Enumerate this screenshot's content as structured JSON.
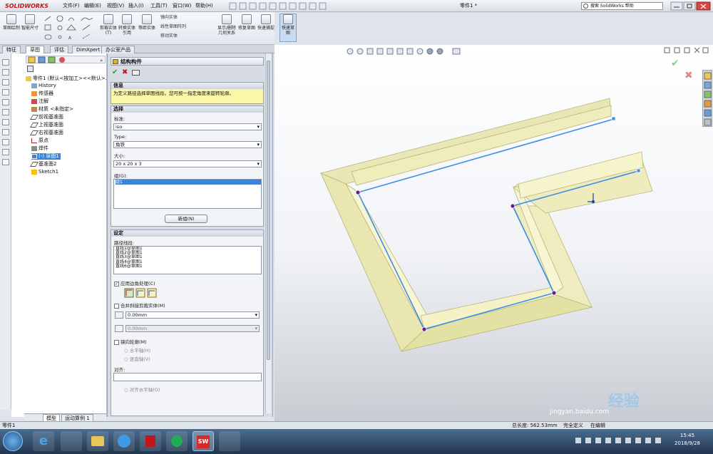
{
  "app": {
    "brand": "SOLIDWORKS",
    "doc_title": "零件1 *",
    "help_search_placeholder": "搜索 SolidWorks 帮助"
  },
  "menu": [
    "文件(F)",
    "编辑(E)",
    "视图(V)",
    "插入(I)",
    "工具(T)",
    "窗口(W)",
    "帮助(H)"
  ],
  "ribbon": {
    "sketch": "草图绘制",
    "smart_dim": "智能尺寸",
    "trim": "剪裁实体(T)",
    "convert": "转换实体引用",
    "offset": "等距实体",
    "mirror": "镜向实体",
    "linear_pattern": "线性草图阵列",
    "move": "移动实体",
    "show_delete": "显示/删除几何关系",
    "repair": "修复草图",
    "quick_snap": "快速捕捉",
    "rapid_sketch": "快速草图"
  },
  "tabs": [
    "特征",
    "草图",
    "评估",
    "DimXpert",
    "办公室产品"
  ],
  "tree": {
    "root": "零件1 (默认<按加工><<默认>...",
    "items": [
      "History",
      "传感器",
      "注解",
      "材质 <未指定>",
      "前视基准面",
      "上视基准面",
      "右视基准面",
      "原点",
      "焊件",
      "(-) 草图1",
      "基准面2",
      "Sketch1"
    ]
  },
  "pm": {
    "title": "结构构件",
    "info_header": "信息",
    "info_text": "为定义路径选择草图线段。您可按一指定角度来旋转轮廓。",
    "sel_header": "选择",
    "standard_label": "标准:",
    "standard": "iso",
    "type_label": "Type:",
    "type": "角铁",
    "size_label": "大小:",
    "size": "20 x 20 x 3",
    "group_label": "组(G):",
    "group_item": "组1",
    "new_group": "新组(N)",
    "settings_header": "设定",
    "path_label": "路径线段:",
    "path_items": [
      "直线1@草图1",
      "直线2@草图1",
      "直线3@草图1",
      "直线4@草图1",
      "直线6@草图1"
    ],
    "corner": "应用边角处理(C)",
    "merge": "合并斜接剪裁实体(M)",
    "gap1": "0.00mm",
    "gap2": "0.00mm",
    "mirror_profile": "镜向轮廓(M)",
    "horiz_axis": "水平轴(H)",
    "vert_axis": "竖直轴(V)",
    "align_label": "对齐:",
    "align_horiz": "对齐水平轴(O)"
  },
  "bottom_tabs": [
    "模型",
    "运动算例 1"
  ],
  "status": {
    "left": "零件1",
    "length": "总长度: 562.53mm",
    "defined": "完全定义",
    "editing": "在编辑"
  },
  "watermark": {
    "brand": "Bai",
    "brand2": "经验",
    "url": "jingyan.baidu.com"
  },
  "clock": {
    "time": "15:45",
    "date": "2018/9/28"
  },
  "colors": {
    "frame": "#efeec0",
    "frame_dark": "#c9c78e",
    "path": "#3e8fe6",
    "point": "#6a1a8a"
  }
}
